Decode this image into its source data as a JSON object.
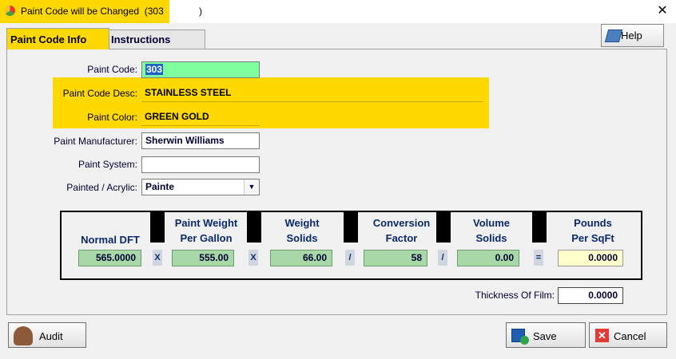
{
  "window": {
    "title": "Paint Code will be Changed  (303",
    "title_suffix": ")",
    "close_glyph": "✕"
  },
  "tabs": [
    {
      "label": "Paint Code Info",
      "active": true
    },
    {
      "label": "Instructions",
      "active": false
    }
  ],
  "help_button": {
    "label": "Help",
    "icon": "book-icon"
  },
  "form": {
    "paint_code": {
      "label": "Paint Code:",
      "value": "303"
    },
    "paint_code_desc": {
      "label": "Paint Code Desc:",
      "value": "STAINLESS STEEL"
    },
    "paint_color": {
      "label": "Paint Color:",
      "value": "GREEN GOLD"
    },
    "paint_manufacturer": {
      "label": "Paint Manufacturer:",
      "value": "Sherwin Williams"
    },
    "paint_system": {
      "label": "Paint System:",
      "value": ""
    },
    "painted_acrylic": {
      "label": "Painted / Acrylic:",
      "value": "Painte"
    }
  },
  "calc": {
    "columns": [
      {
        "header_line1": "",
        "header_line2": "Normal DFT",
        "value": "565.0000"
      },
      {
        "header_line1": "Paint Weight",
        "header_line2": "Per Gallon",
        "value": "555.00"
      },
      {
        "header_line1": "Weight",
        "header_line2": "Solids",
        "value": "66.00"
      },
      {
        "header_line1": "Conversion",
        "header_line2": "Factor",
        "value": "58"
      },
      {
        "header_line1": "Volume",
        "header_line2": "Solids",
        "value": "0.00"
      },
      {
        "header_line1": "Pounds",
        "header_line2": "Per SqFt",
        "value": "0.0000"
      }
    ],
    "operators": [
      "X",
      "X",
      "/",
      "/",
      "="
    ]
  },
  "thickness": {
    "label": "Thickness Of Film:",
    "value": "0.0000"
  },
  "buttons": {
    "audit": "Audit",
    "save": "Save",
    "cancel": "Cancel"
  },
  "colors": {
    "highlight": "#ffd800",
    "code_field": "#80ff9e",
    "calc_value": "#a8d8a8",
    "result_value": "#ffffcc"
  }
}
